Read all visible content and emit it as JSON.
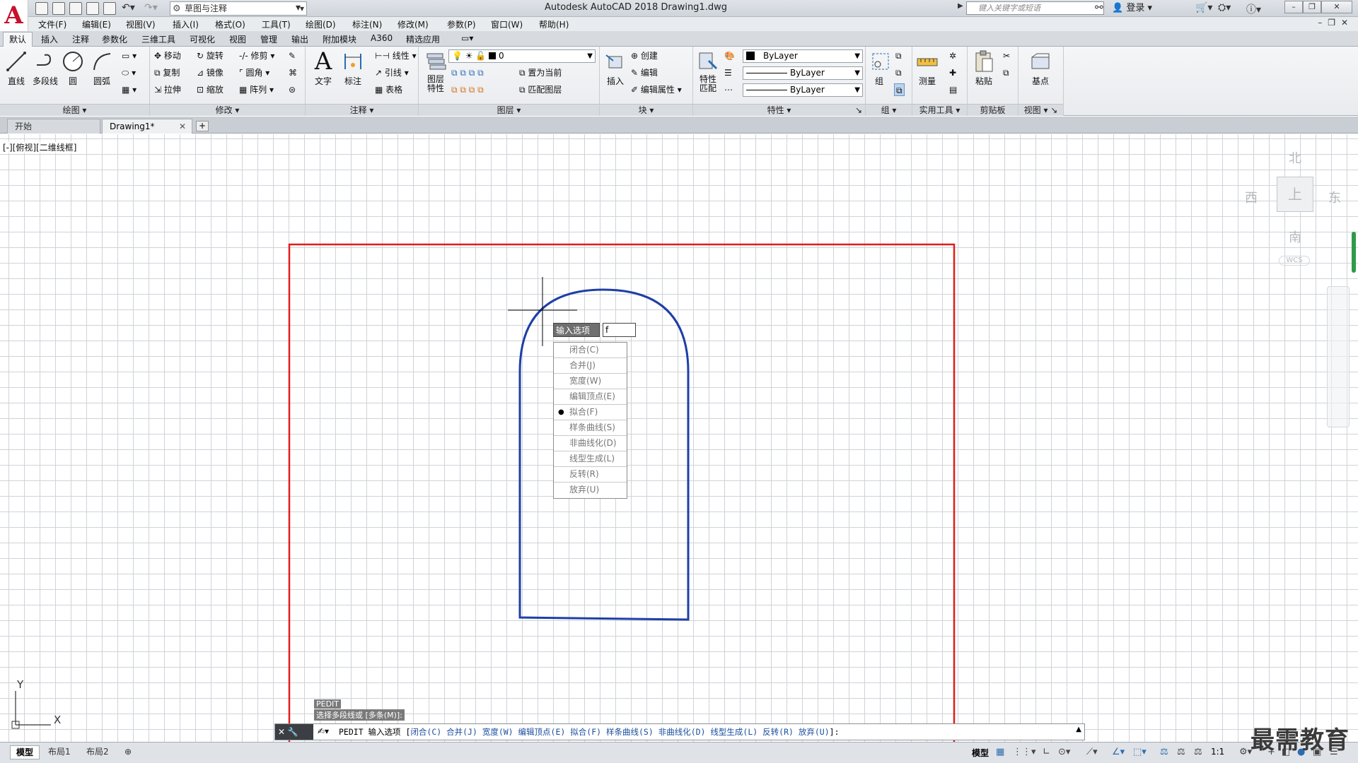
{
  "window": {
    "title": "Autodesk AutoCAD 2018    Drawing1.dwg",
    "workspace": "草图与注释",
    "search_placeholder": "键入关键字或短语",
    "login": "登录",
    "logo_letter": "A"
  },
  "menubar": [
    "文件(F)",
    "编辑(E)",
    "视图(V)",
    "插入(I)",
    "格式(O)",
    "工具(T)",
    "绘图(D)",
    "标注(N)",
    "修改(M)",
    "参数(P)",
    "窗口(W)",
    "帮助(H)"
  ],
  "ribbon_tabs": [
    "默认",
    "插入",
    "注释",
    "参数化",
    "三维工具",
    "可视化",
    "视图",
    "管理",
    "输出",
    "附加模块",
    "A360",
    "精选应用"
  ],
  "ribbon": {
    "draw": {
      "title": "绘图",
      "tools": [
        "直线",
        "多段线",
        "圆",
        "圆弧"
      ]
    },
    "modify": {
      "title": "修改",
      "tools": [
        "移动",
        "旋转",
        "修剪",
        "复制",
        "镜像",
        "圆角",
        "拉伸",
        "缩放",
        "阵列"
      ]
    },
    "annotation": {
      "title": "注释",
      "tools": [
        "文字",
        "标注",
        "线性",
        "引线",
        "表格"
      ]
    },
    "layers": {
      "title": "图层",
      "tools": [
        "图层特性",
        "置为当前",
        "匹配图层"
      ],
      "current_layer": "0"
    },
    "block": {
      "title": "块",
      "tools": [
        "插入",
        "创建",
        "编辑",
        "编辑属性"
      ]
    },
    "properties": {
      "title": "特性",
      "tools": [
        "特性匹配"
      ],
      "color": "ByLayer",
      "linetype": "ByLayer",
      "lineweight": "ByLayer"
    },
    "groups": {
      "title": "组",
      "tools": [
        "组"
      ]
    },
    "utilities": {
      "title": "实用工具",
      "tools": [
        "测量"
      ]
    },
    "clipboard": {
      "title": "剪贴板",
      "tools": [
        "粘贴"
      ]
    },
    "view": {
      "title": "视图",
      "tools": [
        "基点"
      ]
    }
  },
  "doc_tabs": [
    {
      "label": "开始",
      "active": false
    },
    {
      "label": "Drawing1*",
      "active": true
    }
  ],
  "viewport_label": "[-][俯视][二维线框]",
  "viewcube": {
    "north": "北",
    "south": "南",
    "east": "东",
    "west": "西",
    "face": "上",
    "wcs": "WCS"
  },
  "dynamic_input": {
    "label": "输入选项",
    "value": "f",
    "options": [
      "闭合(C)",
      "合并(J)",
      "宽度(W)",
      "编辑顶点(E)",
      "拟合(F)",
      "样条曲线(S)",
      "非曲线化(D)",
      "线型生成(L)",
      "反转(R)",
      "放弃(U)"
    ],
    "selected_index": 4
  },
  "ucs": {
    "x": "X",
    "y": "Y"
  },
  "command": {
    "history": [
      "PEDIT",
      "选择多段线或 [多条(M)]:"
    ],
    "prompt_cmd": "PEDIT 输入选项 [",
    "options": [
      "闭合(C)",
      "合并(J)",
      "宽度(W)",
      "编辑顶点(E)",
      "拟合(F)",
      "样条曲线(S)",
      "非曲线化(D)",
      "线型生成(L)",
      "反转(R)",
      "放弃(U)"
    ],
    "prompt_end": "]:"
  },
  "layout_tabs": [
    {
      "label": "模型",
      "active": true
    },
    {
      "label": "布局1",
      "active": false
    },
    {
      "label": "布局2",
      "active": false
    }
  ],
  "status": {
    "model": "模型",
    "scale": "1:1"
  },
  "watermark": "最需教育",
  "colors": {
    "highlight_frame": "#e31b1b",
    "polyline": "#1f3fa6",
    "crosshair": "#000000"
  }
}
